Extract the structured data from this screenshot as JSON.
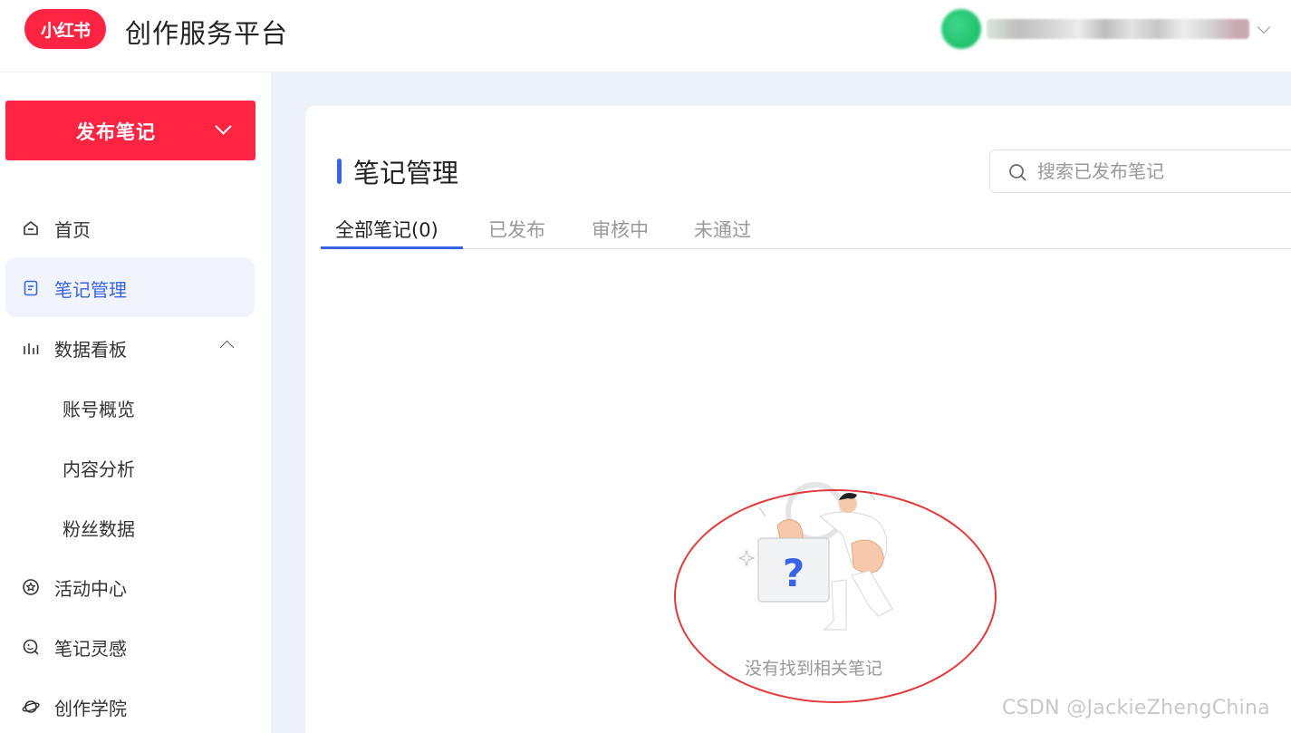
{
  "header": {
    "logo_text": "小红书",
    "platform_title": "创作服务平台",
    "colors": {
      "brand": "#ff2442"
    }
  },
  "sidebar": {
    "publish_button": "发布笔记",
    "items": [
      {
        "label": "首页",
        "icon": "home-icon"
      },
      {
        "label": "笔记管理",
        "icon": "note-icon",
        "active": true
      },
      {
        "label": "数据看板",
        "icon": "bar-chart-icon",
        "expanded": true
      },
      {
        "label": "账号概览",
        "sub": true
      },
      {
        "label": "内容分析",
        "sub": true
      },
      {
        "label": "粉丝数据",
        "sub": true
      },
      {
        "label": "活动中心",
        "icon": "star-badge-icon"
      },
      {
        "label": "笔记灵感",
        "icon": "inspiration-icon"
      },
      {
        "label": "创作学院",
        "icon": "planet-icon"
      }
    ]
  },
  "main": {
    "title": "笔记管理",
    "search": {
      "placeholder": "搜索已发布笔记"
    },
    "tabs": [
      {
        "label": "全部笔记(0)",
        "active": true
      },
      {
        "label": "已发布"
      },
      {
        "label": "审核中"
      },
      {
        "label": "未通过"
      }
    ],
    "empty_state": {
      "text": "没有找到相关笔记"
    },
    "accent_color": "#3a64e8"
  },
  "watermark": "CSDN @JackieZhengChina"
}
